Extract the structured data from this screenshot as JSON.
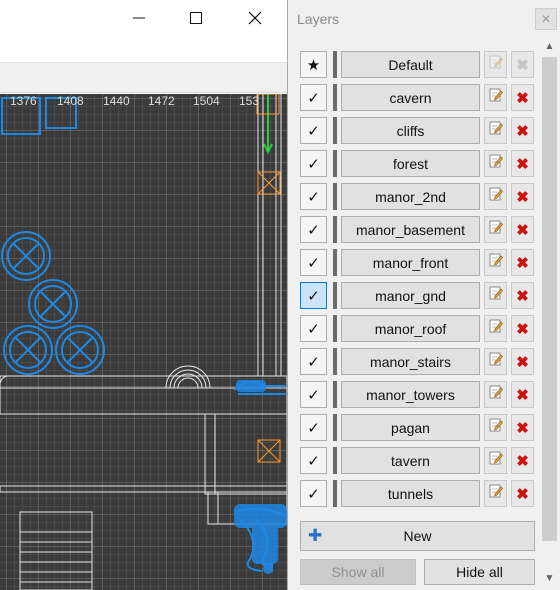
{
  "window": {
    "minimize_icon": "minimize-icon",
    "maximize_icon": "maximize-icon",
    "close_icon": "close-icon"
  },
  "viewport": {
    "ruler_labels": [
      "1376",
      "1408",
      "1440",
      "1472",
      "1504",
      "153"
    ],
    "colors": {
      "background": "#3b3b3b",
      "selection": "#1e88e5",
      "highlight": "#ff9a2e",
      "guide": "#2ecc40"
    }
  },
  "panel": {
    "title": "Layers",
    "close_label": "✕",
    "layers": [
      {
        "name": "Default",
        "visible_icon": "star-icon",
        "glyph": "★",
        "selected": false,
        "editable": false
      },
      {
        "name": "cavern",
        "visible_icon": "check-icon",
        "glyph": "✓",
        "selected": false,
        "editable": true
      },
      {
        "name": "cliffs",
        "visible_icon": "check-icon",
        "glyph": "✓",
        "selected": false,
        "editable": true
      },
      {
        "name": "forest",
        "visible_icon": "check-icon",
        "glyph": "✓",
        "selected": false,
        "editable": true
      },
      {
        "name": "manor_2nd",
        "visible_icon": "check-icon",
        "glyph": "✓",
        "selected": false,
        "editable": true
      },
      {
        "name": "manor_basement",
        "visible_icon": "check-icon",
        "glyph": "✓",
        "selected": false,
        "editable": true
      },
      {
        "name": "manor_front",
        "visible_icon": "check-icon",
        "glyph": "✓",
        "selected": false,
        "editable": true
      },
      {
        "name": "manor_gnd",
        "visible_icon": "check-icon",
        "glyph": "✓",
        "selected": true,
        "editable": true
      },
      {
        "name": "manor_roof",
        "visible_icon": "check-icon",
        "glyph": "✓",
        "selected": false,
        "editable": true
      },
      {
        "name": "manor_stairs",
        "visible_icon": "check-icon",
        "glyph": "✓",
        "selected": false,
        "editable": true
      },
      {
        "name": "manor_towers",
        "visible_icon": "check-icon",
        "glyph": "✓",
        "selected": false,
        "editable": true
      },
      {
        "name": "pagan",
        "visible_icon": "check-icon",
        "glyph": "✓",
        "selected": false,
        "editable": true
      },
      {
        "name": "tavern",
        "visible_icon": "check-icon",
        "glyph": "✓",
        "selected": false,
        "editable": true
      },
      {
        "name": "tunnels",
        "visible_icon": "check-icon",
        "glyph": "✓",
        "selected": false,
        "editable": true
      }
    ],
    "delete_glyph": "✖",
    "new_label": "New",
    "new_icon": "plus-icon",
    "new_glyph": "✚",
    "show_all_label": "Show all",
    "hide_all_label": "Hide all"
  },
  "colors": {
    "delete": "#cc1111",
    "selected_toggle": "#cce4f7",
    "selected_border": "#0078d7"
  }
}
